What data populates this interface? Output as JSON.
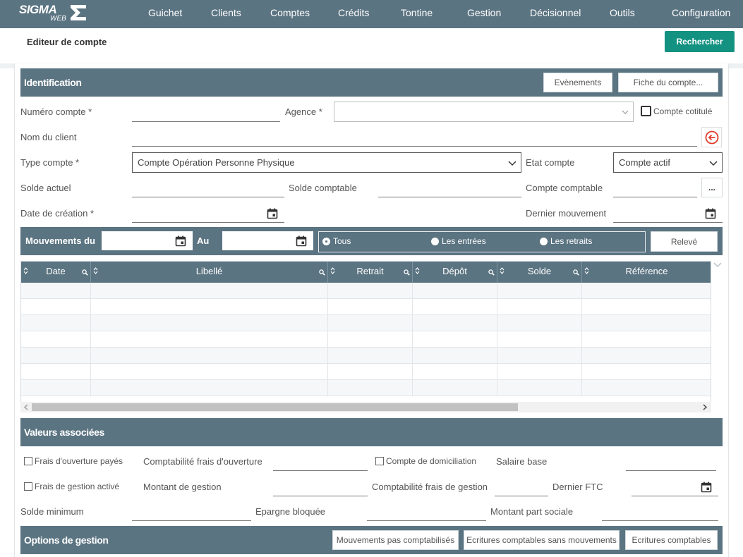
{
  "app": {
    "logo_line1": "SIGMA",
    "logo_line2": "WEB"
  },
  "nav": {
    "items": [
      "Guichet",
      "Clients",
      "Comptes",
      "Crédits",
      "Tontine",
      "Gestion",
      "Décisionnel",
      "Outils",
      "Configuration"
    ]
  },
  "header": {
    "title": "Editeur de compte",
    "search_button": "Rechercher"
  },
  "identification": {
    "title": "Identification",
    "btn_events": "Evènements",
    "btn_fiche": "Fiche du compte...",
    "lbl_numero": "Numéro compte *",
    "lbl_agence": "Agence *",
    "lbl_cotitule": "Compte cotitulé",
    "lbl_nom_client": "Nom du client",
    "lbl_type_compte": "Type compte *",
    "type_compte_value": "Compte Opération Personne Physique",
    "lbl_etat": "Etat compte",
    "etat_value": "Compte actif",
    "lbl_solde_actuel": "Solde actuel",
    "lbl_solde_comptable": "Solde comptable",
    "lbl_compte_comptable": "Compte comptable",
    "btn_more": "...",
    "lbl_date_creation": "Date de création *",
    "lbl_dernier_mvt": "Dernier mouvement"
  },
  "movements": {
    "lbl_du": "Mouvements du",
    "lbl_au": "Au",
    "radio_all": "Tous",
    "radio_in": "Les entrées",
    "radio_out": "Les retraits",
    "btn_releve": "Relevé"
  },
  "grid": {
    "columns": [
      "Date",
      "Libellé",
      "Retrait",
      "Dépôt",
      "Solde",
      "Référence"
    ],
    "row_count": 7
  },
  "valeurs": {
    "title": "Valeurs associées",
    "cb_frais_ouverture": "Frais d'ouverture payés",
    "lbl_compta_frais_ouverture": "Comptabilité frais d'ouverture",
    "cb_domiciliation": "Compte de domiciliation",
    "lbl_salaire_base": "Salaire base",
    "cb_frais_gestion": "Frais de gestion activé",
    "lbl_montant_gestion": "Montant de gestion",
    "lbl_compta_frais_gestion": "Comptabilité frais de gestion",
    "lbl_dernier_ftc": "Dernier FTC",
    "lbl_solde_minimum": "Solde minimum",
    "lbl_epargne_bloquee": "Epargne bloquée",
    "lbl_montant_part": "Montant part sociale"
  },
  "options": {
    "title": "Options de gestion",
    "btn_mvt_non_compta": "Mouvements pas comptabilisés",
    "btn_ecritures_sans_mvt": "Ecritures comptables sans mouvements",
    "btn_ecritures": "Ecritures comptables"
  },
  "colors": {
    "topbar": "#5b7482",
    "primary": "#139181",
    "danger": "#e23b2e"
  }
}
